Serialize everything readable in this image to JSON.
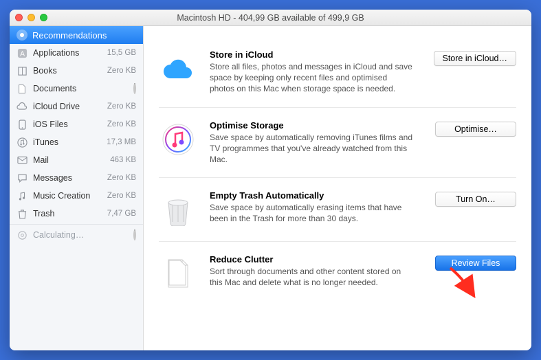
{
  "titlebar": {
    "title": "Macintosh HD - 404,99 GB available of 499,9 GB"
  },
  "sidebar": {
    "header": {
      "label": "Recommendations"
    },
    "items": [
      {
        "icon": "app-icon",
        "label": "Applications",
        "meta": "15,5 GB"
      },
      {
        "icon": "book-icon",
        "label": "Books",
        "meta": "Zero KB"
      },
      {
        "icon": "doc-icon",
        "label": "Documents",
        "meta": "",
        "spinner": true
      },
      {
        "icon": "cloud-icon",
        "label": "iCloud Drive",
        "meta": "Zero KB"
      },
      {
        "icon": "ios-icon",
        "label": "iOS Files",
        "meta": "Zero KB"
      },
      {
        "icon": "itunes-icon",
        "label": "iTunes",
        "meta": "17,3 MB"
      },
      {
        "icon": "mail-icon",
        "label": "Mail",
        "meta": "463 KB"
      },
      {
        "icon": "msg-icon",
        "label": "Messages",
        "meta": "Zero KB"
      },
      {
        "icon": "music-icon",
        "label": "Music Creation",
        "meta": "Zero KB"
      },
      {
        "icon": "trash-icon",
        "label": "Trash",
        "meta": "7,47 GB"
      },
      {
        "icon": "gear-icon",
        "label": "Calculating…",
        "meta": "",
        "spinner": true,
        "muted": true
      }
    ]
  },
  "sections": [
    {
      "id": "icloud",
      "title": "Store in iCloud",
      "desc": "Store all files, photos and messages in iCloud and save space by keeping only recent files and optimised photos on this Mac when storage space is needed.",
      "button": "Store in iCloud…",
      "primary": false
    },
    {
      "id": "optimise",
      "title": "Optimise Storage",
      "desc": "Save space by automatically removing iTunes films and TV programmes that you've already watched from this Mac.",
      "button": "Optimise…",
      "primary": false
    },
    {
      "id": "trash",
      "title": "Empty Trash Automatically",
      "desc": "Save space by automatically erasing items that have been in the Trash for more than 30 days.",
      "button": "Turn On…",
      "primary": false
    },
    {
      "id": "clutter",
      "title": "Reduce Clutter",
      "desc": "Sort through documents and other content stored on this Mac and delete what is no longer needed.",
      "button": "Review Files",
      "primary": true
    }
  ]
}
